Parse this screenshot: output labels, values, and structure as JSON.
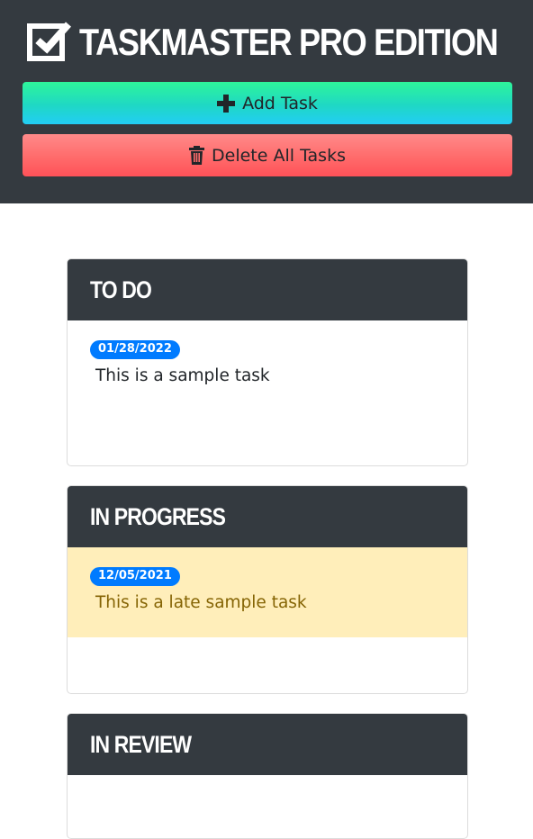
{
  "app": {
    "title": "TASKMASTER PRO EDITION",
    "title_icon": "checkbox-checked-icon"
  },
  "toolbar": {
    "add_label": "Add Task",
    "add_icon": "plus-icon",
    "delete_label": "Delete All Tasks",
    "delete_icon": "trash-icon"
  },
  "columns": [
    {
      "title": "TO DO",
      "tasks": [
        {
          "date": "01/28/2022",
          "text": "This is a sample task",
          "late": false
        }
      ]
    },
    {
      "title": "IN PROGRESS",
      "tasks": [
        {
          "date": "12/05/2021",
          "text": "This is a late sample task",
          "late": true
        }
      ]
    },
    {
      "title": "IN REVIEW",
      "tasks": []
    }
  ],
  "colors": {
    "header_bg": "#343a40",
    "badge": "#007bff",
    "late_bg": "#ffeeba",
    "late_text": "#856404"
  }
}
